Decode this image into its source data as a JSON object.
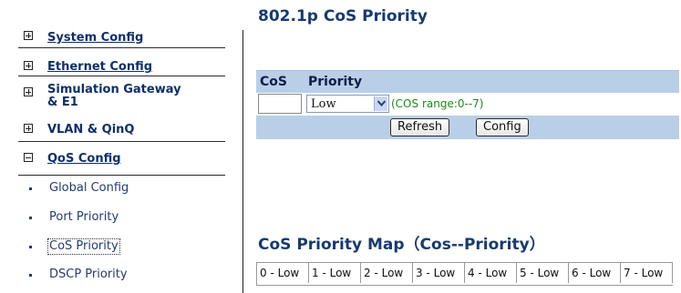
{
  "sidebar": {
    "items": [
      {
        "label": "System Config",
        "expanded": false
      },
      {
        "label": "Ethernet Config",
        "expanded": false
      },
      {
        "label_line1": "Simulation Gateway",
        "label_line2": "& E1",
        "expanded": false
      },
      {
        "label": "VLAN & QinQ",
        "expanded": false
      },
      {
        "label": "QoS Config",
        "expanded": true
      }
    ],
    "subitems": [
      {
        "label": "Global Config"
      },
      {
        "label": "Port Priority"
      },
      {
        "label": "CoS Priority",
        "active": true
      },
      {
        "label": "DSCP Priority"
      }
    ]
  },
  "main": {
    "title": "802.1p CoS Priority",
    "table": {
      "col_cos": "CoS",
      "col_priority": "Priority",
      "cos_value": "",
      "priority_selected": "Low",
      "range_hint": "(COS range:0--7)",
      "refresh_label": "Refresh",
      "config_label": "Config"
    },
    "map_title": "CoS Priority Map（Cos--Priority）",
    "map": [
      "0 - Low",
      "1 - Low",
      "2 - Low",
      "3 - Low",
      "4 - Low",
      "5 - Low",
      "6 - Low",
      "7 - Low"
    ]
  },
  "colors": {
    "header_bg": "#b9cfe8",
    "title": "#173a70",
    "hint_green": "#1a8a1a"
  }
}
